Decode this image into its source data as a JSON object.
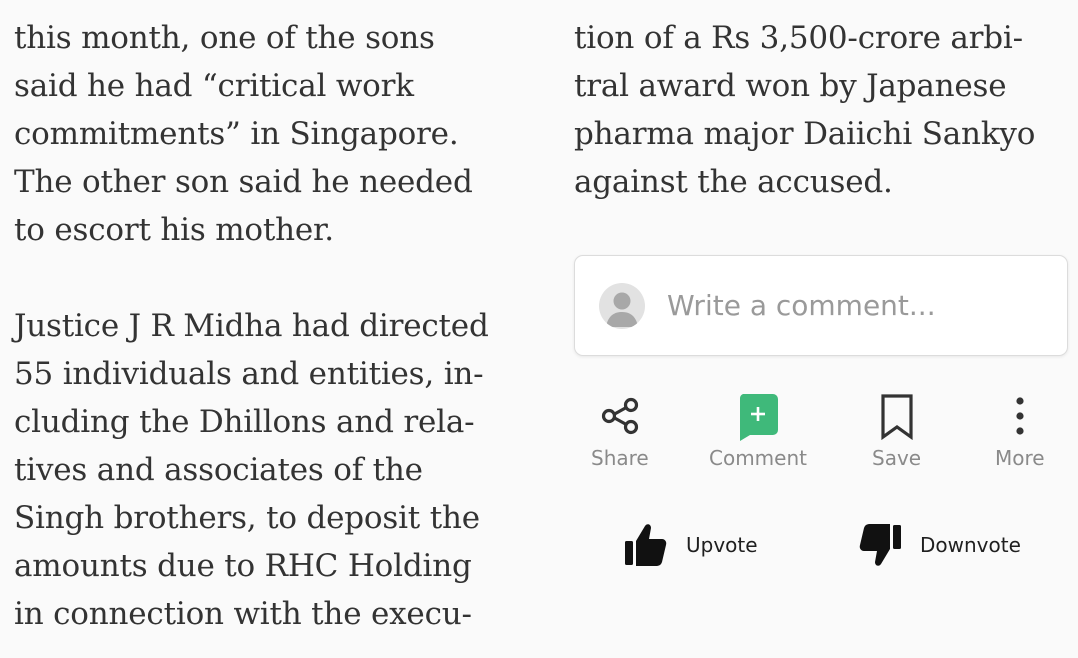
{
  "article": {
    "left_column": {
      "paragraph_1": [
        "this month, one of the sons",
        "said he had “critical work",
        "commitments” in Singapore.",
        "The other son said he needed",
        "to escort his mother."
      ],
      "paragraph_2": [
        "Justice J R Midha had directed",
        "55 individuals and entities, in-",
        "cluding the Dhillons and rela-",
        "tives and associates of the",
        "Singh brothers, to deposit the",
        "amounts due to RHC Holding",
        "in connection with the execu-"
      ]
    },
    "right_column": [
      "tion of a Rs 3,500-crore arbi-",
      "tral award won by Japanese",
      "pharma major Daiichi Sankyo",
      "against the accused."
    ]
  },
  "comment": {
    "placeholder": "Write a comment..."
  },
  "actions": {
    "share": "Share",
    "comment": "Comment",
    "save": "Save",
    "more": "More"
  },
  "votes": {
    "upvote": "Upvote",
    "downvote": "Downvote"
  },
  "colors": {
    "accent_green": "#3fb97a",
    "text": "#333333",
    "muted": "#8a8a8a"
  },
  "icons": [
    "avatar-icon",
    "share-icon",
    "comment-plus-icon",
    "bookmark-icon",
    "more-vertical-icon",
    "thumbs-up-icon",
    "thumbs-down-icon"
  ]
}
